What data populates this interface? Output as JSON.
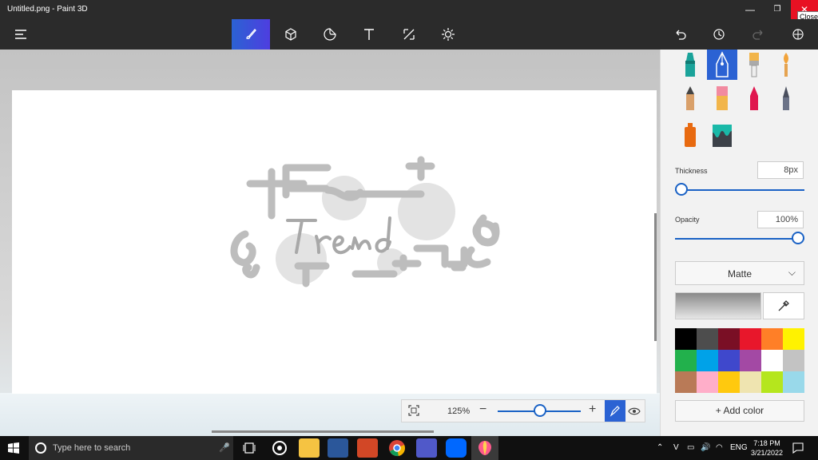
{
  "window": {
    "title": "Untitled.png - Paint 3D",
    "minimize": "—",
    "maximize": "❐",
    "close": "✕",
    "close_tooltip": "Close"
  },
  "toolbar": {
    "items": [
      "menu-icon",
      "brushes-icon",
      "3d-shapes-icon",
      "stickers-icon",
      "text-icon",
      "canvas-icon",
      "effects-icon",
      "undo-icon",
      "history-icon",
      "redo-icon",
      "3d-library-icon"
    ],
    "active": "brushes-icon"
  },
  "canvas": {
    "drawing_text": "Trend"
  },
  "zoom": {
    "percent": "125%",
    "minus": "−",
    "plus": "+",
    "level": 0.5
  },
  "panel": {
    "thickness_label": "Thickness",
    "thickness_value": "8px",
    "thickness_level": 0.0,
    "opacity_label": "Opacity",
    "opacity_value": "100%",
    "opacity_level": 1.0,
    "finish_value": "Matte",
    "add_color_label": "Add color",
    "brushes": [
      "marker-icon",
      "calligraphy-pen-icon",
      "oil-brush-icon",
      "watercolor-icon",
      "pencil-icon",
      "eraser-icon",
      "crayon-icon",
      "pixel-pen-icon",
      "spray-can-icon",
      "fill-bucket-icon"
    ],
    "selected_brush": "calligraphy-pen-icon",
    "palette": [
      "#000000",
      "#4d4d4d",
      "#7a0f25",
      "#e8172b",
      "#ff7f27",
      "#fff200",
      "#22b14c",
      "#00a2e8",
      "#3f48cc",
      "#a349a4",
      "#ffffff",
      "#c3c3c3",
      "#b97a57",
      "#ffaec9",
      "#ffc90e",
      "#efe4b0",
      "#b5e61d",
      "#99d9ea"
    ]
  },
  "taskbar": {
    "search_placeholder": "Type here to search",
    "language": "ENG",
    "time": "7:18 PM",
    "date": "3/21/2022"
  }
}
